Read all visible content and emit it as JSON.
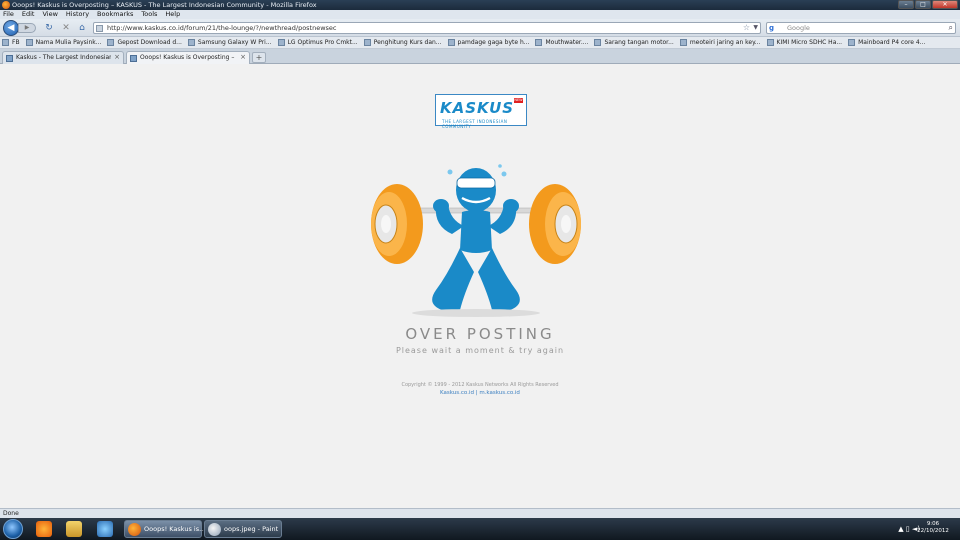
{
  "window": {
    "title": "Ooops! Kaskus is Overposting – KASKUS - The Largest Indonesian Community - Mozilla Firefox",
    "controls": [
      "–",
      "□",
      "✕"
    ]
  },
  "menu": [
    "File",
    "Edit",
    "View",
    "History",
    "Bookmarks",
    "Tools",
    "Help"
  ],
  "nav": {
    "url": "http://www.kaskus.co.id/forum/21/the-lounge/?/newthread/postnewsec",
    "search_engine": "g",
    "search_placeholder": "Google"
  },
  "bookmarks": [
    "FB",
    "Nama Mulia Paysink...",
    "Gepost Download d...",
    "Samsung Galaxy W Pri...",
    "LG Optimus Pro Cmkt...",
    "Penghitung Kurs dan...",
    "pamdage gaga byte h...",
    "Mouthwater....",
    "Sarang tangan motor...",
    "meoteiri jaring an key...",
    "KIMI Micro SDHC Ha...",
    "Mainboard P4 core 4..."
  ],
  "tabs": [
    {
      "label": "Kaskus - The Largest Indonesian Co...",
      "active": false
    },
    {
      "label": "Ooops! Kaskus is Overposting – K...",
      "active": true
    }
  ],
  "page": {
    "logo_text": "KASKUS",
    "logo_tagline": "THE LARGEST INDONESIAN COMMUNITY",
    "logo_badge": "NEW",
    "heading": "OVER POSTING",
    "subheading": "Please wait a moment & try again",
    "copyright": "Copyright © 1999 - 2012 Kaskus Networks All Rights Reserved",
    "links": "Kaskus.co.id | m.kaskus.co.id"
  },
  "status": {
    "text": "Done"
  },
  "taskbar": {
    "tasks": [
      {
        "label": "Ooops! Kaskus is...",
        "active": true
      },
      {
        "label": "oops.jpeg - Paint",
        "active": false
      }
    ],
    "tray_icons": "▲ ▯ ◄)",
    "clock_time": "9:06",
    "clock_date": "22/10/2012"
  },
  "colors": {
    "kaskus_blue": "#1a8ac8",
    "weight_orange": "#f39a1d",
    "page_bg": "#f1f1f1"
  }
}
